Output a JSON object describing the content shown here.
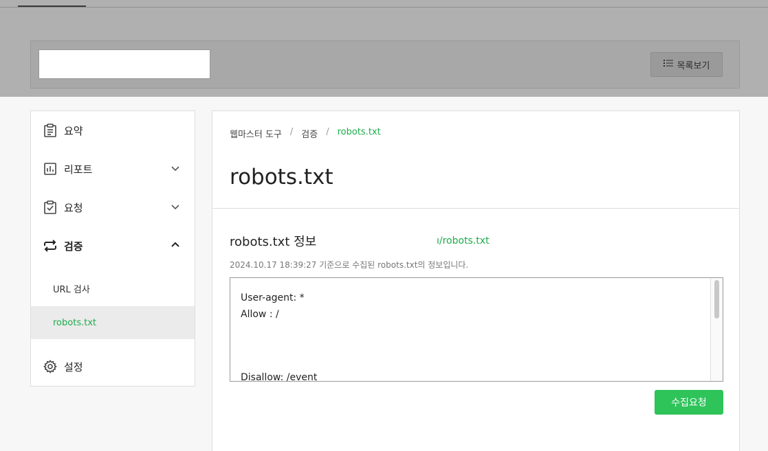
{
  "header": {
    "site_select_value": "",
    "list_button_label": "목록보기",
    "list_icon": "list-icon"
  },
  "sidebar": {
    "items": [
      {
        "label": "요약",
        "icon": "clipboard-icon"
      },
      {
        "label": "리포트",
        "icon": "bar-chart-icon"
      },
      {
        "label": "요청",
        "icon": "clipboard-check-icon"
      },
      {
        "label": "검증",
        "icon": "repeat-icon"
      },
      {
        "label": "설정",
        "icon": "gear-icon"
      }
    ],
    "sub_items": [
      {
        "label": "URL 검사"
      },
      {
        "label": "robots.txt"
      }
    ]
  },
  "breadcrumb": {
    "items": [
      "웹마스터 도구",
      "검증",
      "robots.txt"
    ],
    "separator": "/"
  },
  "main": {
    "title": "robots.txt",
    "section_title": "robots.txt 정보",
    "section_url": "ı/robots.txt",
    "info_text": "2024.10.17 18:39:27 기준으로 수집된 robots.txt의 정보입니다.",
    "robots_content": "User-agent: *\nAllow : /",
    "robots_cut_line": "Disallow: /event",
    "collect_button": "수집요청"
  },
  "colors": {
    "accent": "#1cab4a",
    "button": "#2ec45a"
  }
}
